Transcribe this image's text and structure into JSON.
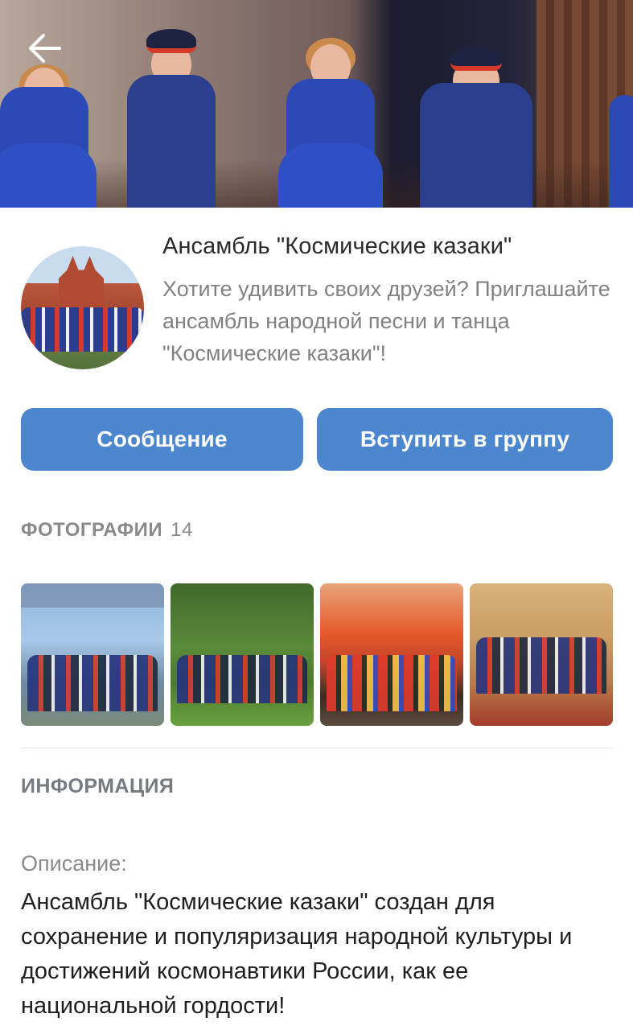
{
  "group": {
    "title": "Ансамбль \"Космические казаки\"",
    "status": "Хотите удивить своих друзей? Приглашайте ансамбль народной песни и танца \"Космические казаки\"!"
  },
  "buttons": {
    "message_label": "Сообщение",
    "join_label": "Вступить в группу"
  },
  "photos": {
    "header": "ФОТОГРАФИИ",
    "count": "14"
  },
  "info": {
    "header": "ИНФОРМАЦИЯ",
    "description_label": "Описание:",
    "description_text": "Ансамбль \"Космические казаки\" создан для сохранение и популяризация народной культуры и достижений космонавтики России, как ее национальной гордости!"
  },
  "icons": {
    "back": "back-arrow-icon"
  },
  "colors": {
    "accent": "#4b86cf",
    "muted_text": "#828282"
  }
}
